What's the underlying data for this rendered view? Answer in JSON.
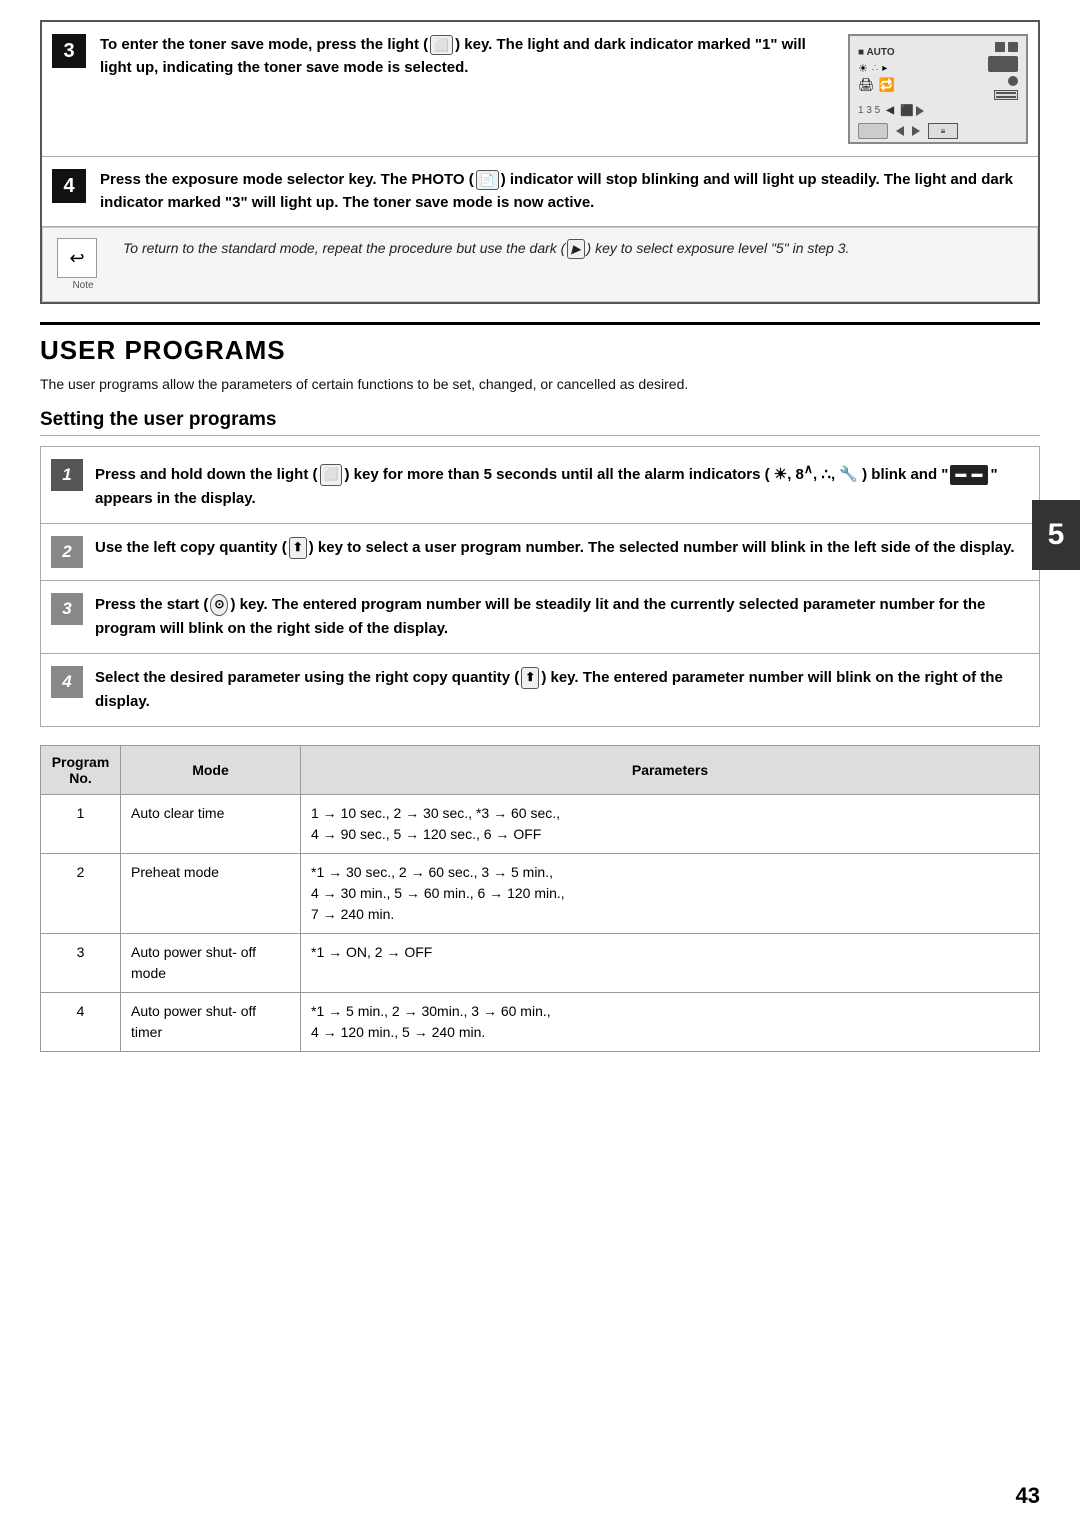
{
  "page": {
    "page_number": "43",
    "section_tab": "5"
  },
  "top_steps": [
    {
      "number": "3",
      "text_parts": [
        "To enter the toner save mode, press the ",
        "light",
        " (",
        "⬜",
        ") key. The light and dark indicator marked \"1\" will light up, indicating the toner save mode is selected."
      ],
      "has_image": true
    },
    {
      "number": "4",
      "text_parts": [
        "Press the exposure mode selector key. The PHOTO (",
        "📄",
        ") indicator will stop blinking and will light up steadily. The light and dark indicator marked \"3\" will light up. The toner save mode is now active."
      ],
      "has_image": false
    }
  ],
  "note": {
    "icon": "↩",
    "label": "Note",
    "text": "To return to the standard mode, repeat the procedure but use the dark ( ▶ ) key to select exposure level \"5\" in step 3."
  },
  "user_programs": {
    "title": "USER PROGRAMS",
    "description": "The user programs allow the parameters of certain functions to be set, changed, or cancelled as desired.",
    "subsection_title": "Setting the user programs",
    "steps": [
      {
        "number": "1",
        "text": "Press and hold down the light (⬜) key for more than 5 seconds until all the alarm indicators ( ☀, 8∧, ∴, 🔧 ) blink and \" ▬▬ \" appears in the display."
      },
      {
        "number": "2",
        "text": "Use the left copy quantity ( ⬆ ) key to select a user program number. The selected number will blink in the left side of the display."
      },
      {
        "number": "3",
        "text": "Press the start (⊙) key. The entered program number will be steadily lit and the currently selected parameter number for the program will blink on the right side of the display."
      },
      {
        "number": "4",
        "text": "Select the desired parameter using the right copy quantity ( ⬆ ) key. The entered parameter number will blink on the right of the display."
      }
    ],
    "table": {
      "headers": [
        "Program No.",
        "Mode",
        "Parameters"
      ],
      "rows": [
        {
          "program": "1",
          "mode": "Auto clear time",
          "parameters": "1 → 10 sec., 2 → 30 sec., *3 → 60 sec.,\n4 → 90 sec., 5 → 120 sec., 6 → OFF"
        },
        {
          "program": "2",
          "mode": "Preheat mode",
          "parameters": "*1 → 30 sec., 2 → 60 sec., 3 → 5 min.,\n4 → 30 min., 5 → 60 min., 6 → 120 min.,\n7 → 240 min."
        },
        {
          "program": "3",
          "mode": "Auto power shut- off mode",
          "parameters": "*1 → ON, 2 → OFF"
        },
        {
          "program": "4",
          "mode": "Auto power shut- off timer",
          "parameters": "*1 → 5 min., 2 → 30min., 3 → 60 min.,\n4 → 120 min., 5 → 240 min."
        }
      ]
    }
  }
}
